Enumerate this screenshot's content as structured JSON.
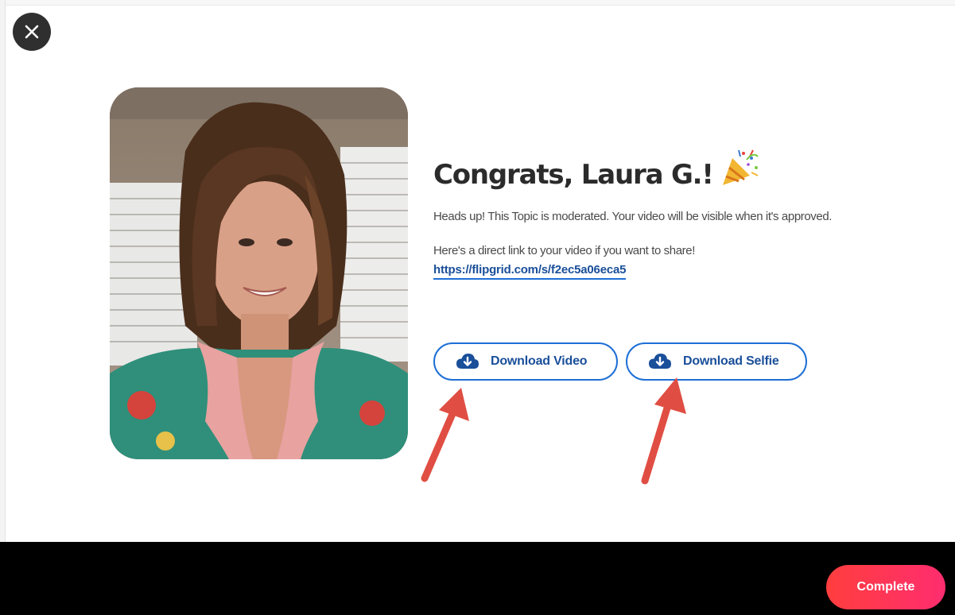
{
  "header": {
    "close_icon": "close-icon"
  },
  "celebration": {
    "title": "Congrats, Laura G.!",
    "title_icon": "party-popper-icon",
    "notice": "Heads up! This Topic is moderated. Your video will be visible when it's approved.",
    "share_text": "Here's a direct link to your video if you want to share!",
    "share_link": "https://flipgrid.com/s/f2ec5a06eca5"
  },
  "downloads": {
    "video_label": "Download Video",
    "selfie_label": "Download Selfie",
    "icon": "cloud-download-icon"
  },
  "footer": {
    "complete_label": "Complete"
  },
  "colors": {
    "accent_blue": "#1e6fd6",
    "link_blue": "#1a4f9a",
    "complete_start": "#ff3e3e",
    "complete_end": "#ff2d6f",
    "annotation_arrow": "#e04e43",
    "footer_bg": "#000000"
  }
}
